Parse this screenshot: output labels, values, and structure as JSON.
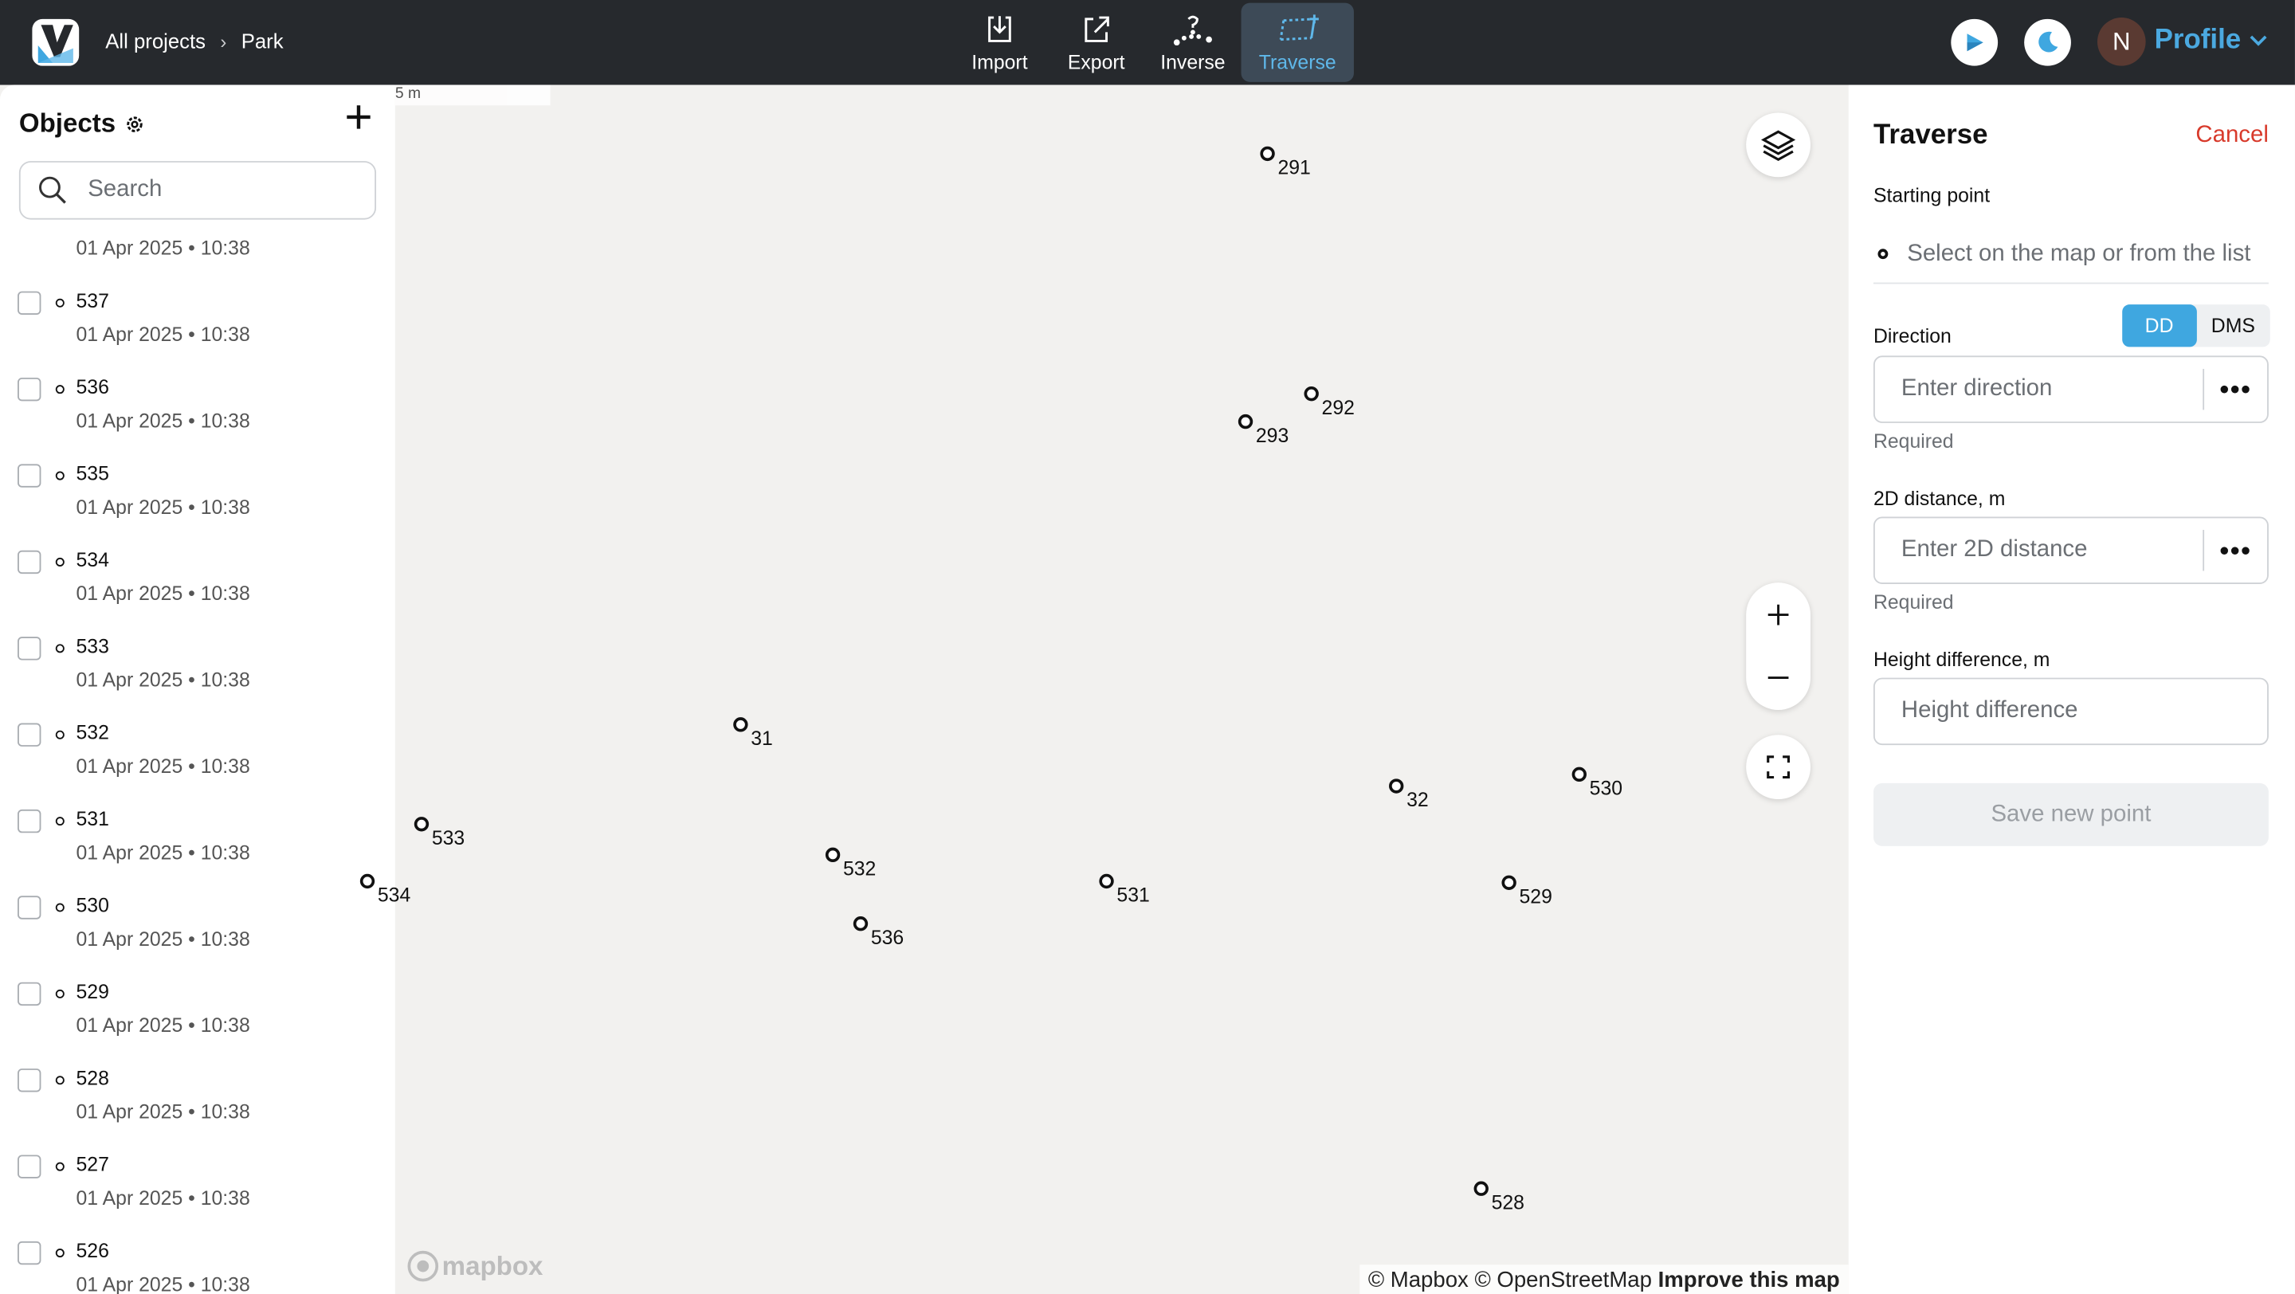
{
  "header": {
    "breadcrumb_root": "All projects",
    "breadcrumb_sep": "›",
    "breadcrumb_current": "Park",
    "tools": [
      {
        "label": "Import",
        "icon": "import-icon"
      },
      {
        "label": "Export",
        "icon": "export-icon"
      },
      {
        "label": "Inverse",
        "icon": "inverse-icon"
      },
      {
        "label": "Traverse",
        "icon": "traverse-icon",
        "active": true
      }
    ],
    "avatar_initial": "N",
    "profile_label": "Profile"
  },
  "objects_panel": {
    "title": "Objects",
    "search_placeholder": "Search",
    "first_partial_date": "01 Apr 2025 • 10:38",
    "items": [
      {
        "name": "537",
        "date": "01 Apr 2025 • 10:38"
      },
      {
        "name": "536",
        "date": "01 Apr 2025 • 10:38"
      },
      {
        "name": "535",
        "date": "01 Apr 2025 • 10:38"
      },
      {
        "name": "534",
        "date": "01 Apr 2025 • 10:38"
      },
      {
        "name": "533",
        "date": "01 Apr 2025 • 10:38"
      },
      {
        "name": "532",
        "date": "01 Apr 2025 • 10:38"
      },
      {
        "name": "531",
        "date": "01 Apr 2025 • 10:38"
      },
      {
        "name": "530",
        "date": "01 Apr 2025 • 10:38"
      },
      {
        "name": "529",
        "date": "01 Apr 2025 • 10:38"
      },
      {
        "name": "528",
        "date": "01 Apr 2025 • 10:38"
      },
      {
        "name": "527",
        "date": "01 Apr 2025 • 10:38"
      },
      {
        "name": "526",
        "date": "01 Apr 2025 • 10:38"
      }
    ]
  },
  "map": {
    "scale_label": "5 m",
    "points": [
      "291",
      "292",
      "293",
      "31",
      "533",
      "534",
      "532",
      "536",
      "531",
      "32",
      "530",
      "529",
      "528"
    ],
    "attribution_mapbox": "© Mapbox",
    "attribution_osm": "© OpenStreetMap",
    "improve_link": "Improve this map",
    "logo_text": "mapbox"
  },
  "traverse_panel": {
    "title": "Traverse",
    "cancel": "Cancel",
    "starting_point_label": "Starting point",
    "starting_point_hint": "Select on the map or from the list",
    "direction_label": "Direction",
    "unit_dd": "DD",
    "unit_dms": "DMS",
    "direction_placeholder": "Enter direction",
    "direction_required": "Required",
    "distance_label": "2D distance, m",
    "distance_placeholder": "Enter 2D distance",
    "distance_required": "Required",
    "height_label": "Height difference, m",
    "height_placeholder": "Height difference",
    "save_label": "Save new point",
    "more_label": "•••"
  },
  "colors": {
    "topbar": "#26292d",
    "accent": "#3fa7e0",
    "cancel": "#d83a2b"
  }
}
